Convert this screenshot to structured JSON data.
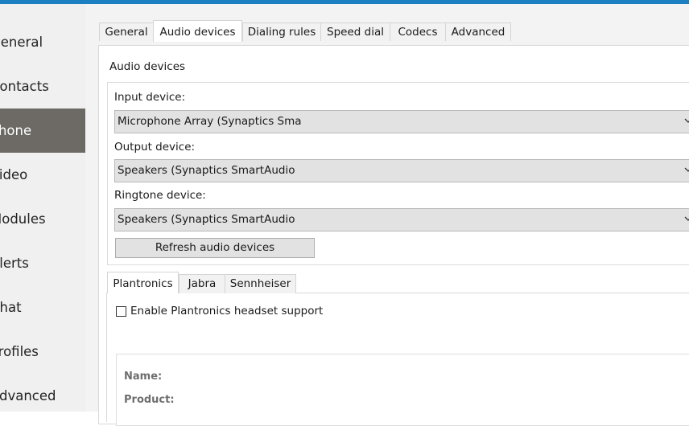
{
  "sidebar": {
    "items": [
      {
        "label": "General"
      },
      {
        "label": "Contacts"
      },
      {
        "label": "Phone",
        "active": true
      },
      {
        "label": "Video"
      },
      {
        "label": "Modules"
      },
      {
        "label": "Alerts"
      },
      {
        "label": "Chat"
      },
      {
        "label": "Profiles"
      },
      {
        "label": "Advanced"
      }
    ]
  },
  "tabs": [
    {
      "label": "General"
    },
    {
      "label": "Audio devices",
      "active": true
    },
    {
      "label": "Dialing rules"
    },
    {
      "label": "Speed dial"
    },
    {
      "label": "Codecs"
    },
    {
      "label": "Advanced"
    }
  ],
  "audio": {
    "section_title": "Audio devices",
    "input_label": "Input device:",
    "input_value": "Microphone Array (Synaptics Sma",
    "output_label": "Output device:",
    "output_value": "Speakers (Synaptics SmartAudio",
    "ringtone_label": "Ringtone device:",
    "ringtone_value": "Speakers (Synaptics SmartAudio",
    "refresh_label": "Refresh audio devices"
  },
  "vendor_tabs": [
    {
      "label": "Plantronics",
      "active": true
    },
    {
      "label": "Jabra"
    },
    {
      "label": "Sennheiser"
    }
  ],
  "headset": {
    "enable_label": "Enable Plantronics headset support",
    "enabled": false,
    "name_label": "Name:",
    "product_label": "Product:"
  },
  "colors": {
    "accent": "#1c7fc1",
    "sidebar_active": "#6d6965"
  },
  "icons": {
    "dropdown": "chevron-down-icon"
  }
}
